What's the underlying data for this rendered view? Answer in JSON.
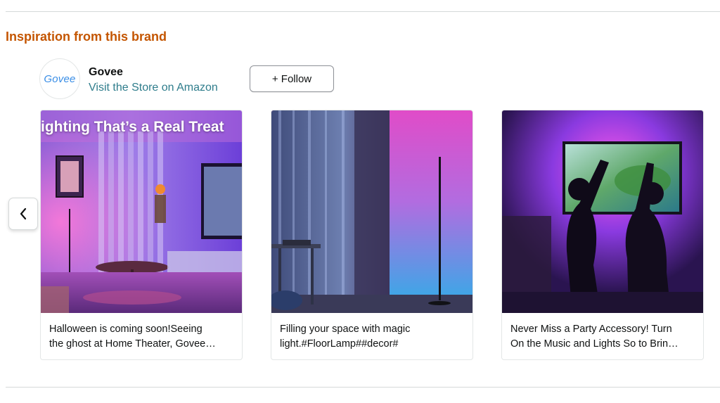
{
  "section": {
    "title": "Inspiration from this brand"
  },
  "brand": {
    "logo_text": "Govee",
    "name": "Govee",
    "store_link": "Visit the Store on Amazon",
    "follow_label": "+ Follow"
  },
  "carousel": {
    "prev_icon": "chevron-left-icon",
    "cards": [
      {
        "overlay_text": "ighting That’s a Real Treat",
        "caption_line1": "Halloween is coming soon!Seeing",
        "caption_line2": "the ghost at Home Theater, Govee…"
      },
      {
        "caption_line1": "Filling your space with magic",
        "caption_line2": "light.#FloorLamp##decor#"
      },
      {
        "caption_line1": "Never Miss a Party Accessory! Turn",
        "caption_line2": "On the Music and Lights So to Brin…"
      }
    ]
  },
  "colors": {
    "section_title": "#c45500",
    "link": "#2f7d8c",
    "logo": "#3a8ee6"
  }
}
